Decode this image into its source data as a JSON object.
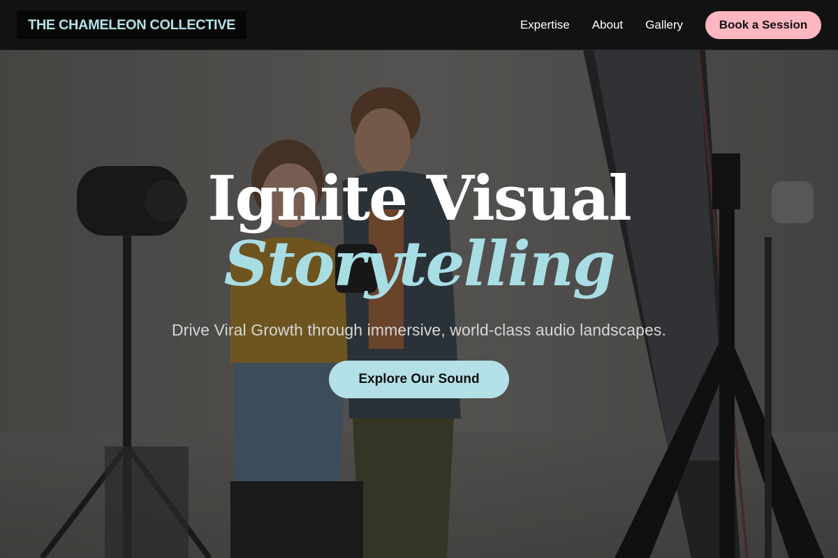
{
  "brand": {
    "name": "THE CHAMELEON COLLECTIVE"
  },
  "nav": {
    "links": [
      "Expertise",
      "About",
      "Gallery"
    ],
    "cta_label": "Book a Session"
  },
  "hero": {
    "title_line1": "Ignite Visual",
    "title_line2": "Storytelling",
    "subtitle": "Drive Viral Growth through immersive, world-class audio landscapes.",
    "cta_label": "Explore Our Sound",
    "background_image": "photo-studio-two-people-with-camera-and-lights"
  },
  "colors": {
    "accent_aqua": "#b3e0e6",
    "accent_pink": "#ffb6c1",
    "nav_background": "#121212",
    "brand_text": "#b3e0e6"
  }
}
